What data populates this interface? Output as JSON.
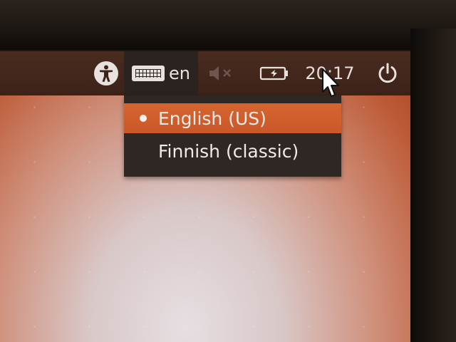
{
  "top_panel": {
    "accessibility_icon": "accessibility-icon",
    "keyboard_indicator": {
      "icon": "keyboard-icon",
      "label": "en"
    },
    "sound_icon": "sound-muted-icon",
    "battery_icon": "battery-charging-icon",
    "clock": "20:17",
    "power_icon": "power-icon"
  },
  "keyboard_menu": {
    "items": [
      {
        "label": "English (US)",
        "selected": true
      },
      {
        "label": "Finnish (classic)",
        "selected": false
      }
    ]
  },
  "colors": {
    "accent": "#d7652f",
    "panel": "#3c2219",
    "menu_background": "#2f2724"
  }
}
